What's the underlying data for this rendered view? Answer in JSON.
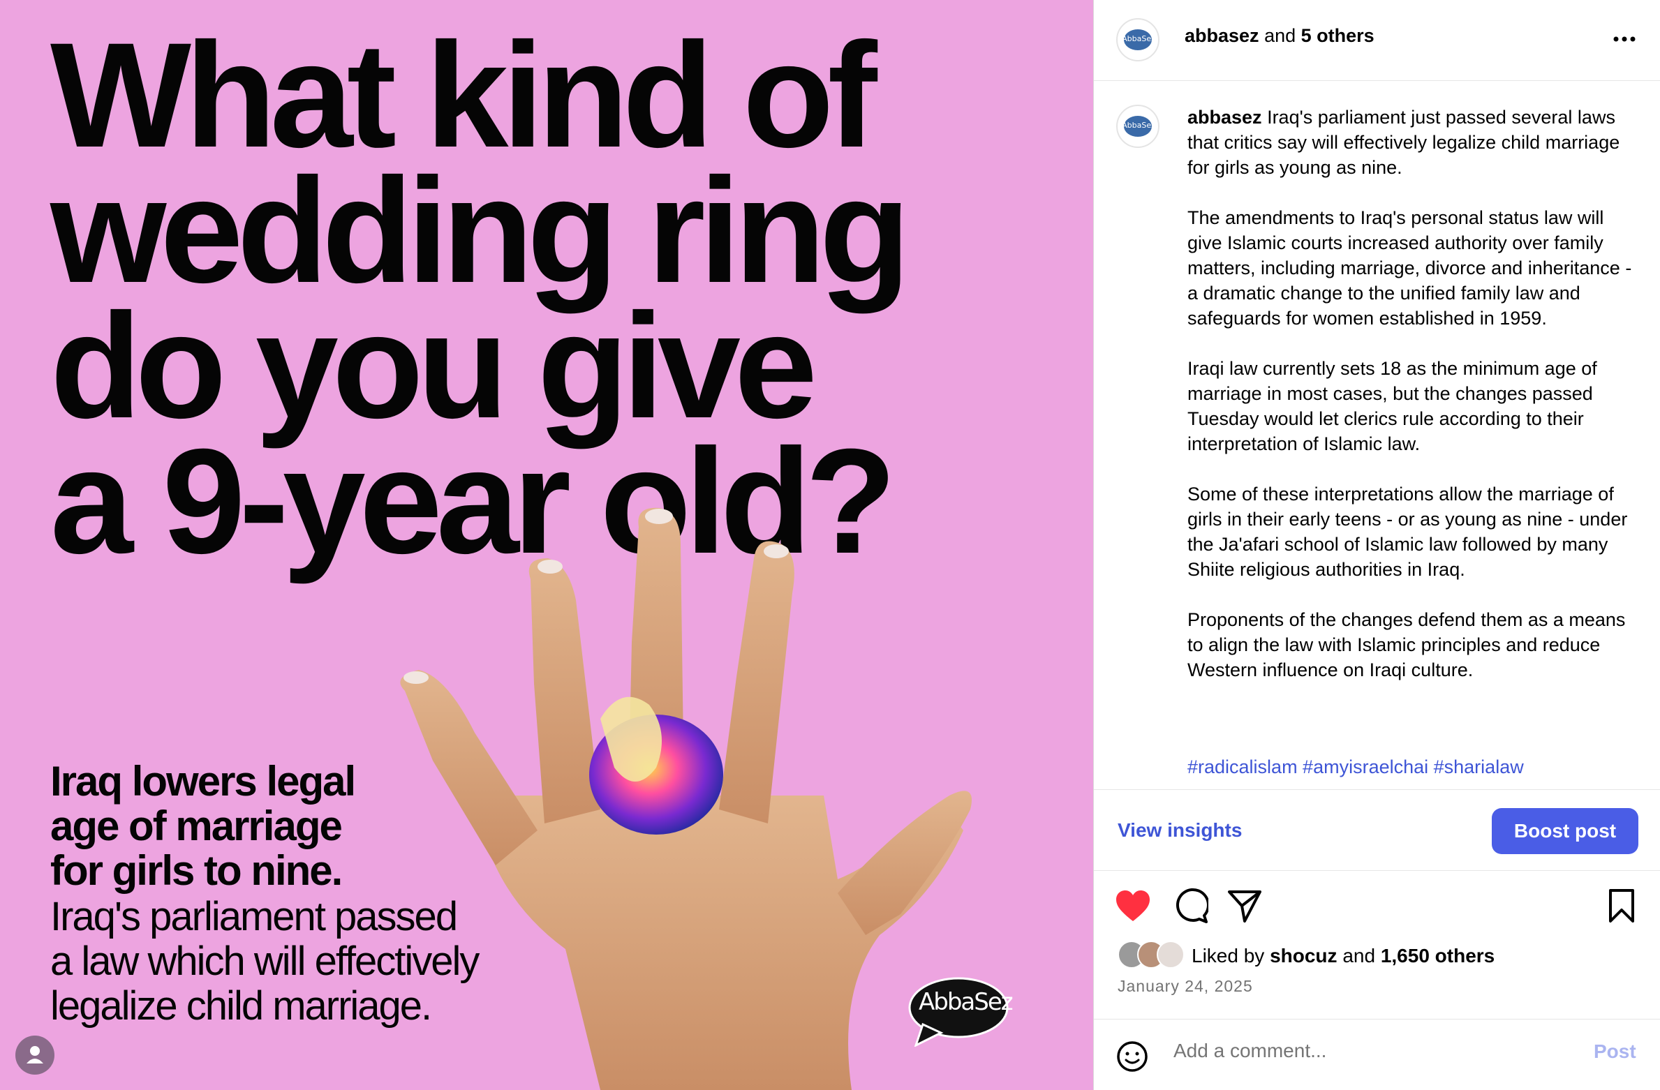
{
  "image": {
    "headline": "What kind of\nwedding ring\ndo you give\na 9-year old?",
    "subhead": "Iraq lowers legal\nage of marriage\nfor girls to nine.",
    "subtext": "Iraq's parliament passed\na law which will effectively\nlegalize child marriage.",
    "logo": "AbbaSez",
    "background_color": "#eda4e0"
  },
  "header": {
    "account": "abbasez",
    "and_text": " and ",
    "others": "5 others"
  },
  "caption": {
    "username": "abbasez",
    "body": " Iraq's parliament just passed several laws that critics say will effectively legalize child marriage for girls as young as nine.\n\nThe amendments to Iraq's personal status law will give Islamic courts increased authority over family matters, including marriage, divorce and inheritance - a dramatic change to the unified family law and safeguards for women established in 1959.\n\nIraqi law currently sets 18 as the minimum age of marriage in most cases, but the changes passed Tuesday would let clerics rule according to their interpretation of Islamic law.\n\nSome of these interpretations allow the marriage of girls in their early teens - or as young as nine - under the Ja'afari school of Islamic law followed by many Shiite religious authorities in Iraq.\n\nProponents of the changes defend them as a means to align the law with Islamic principles and reduce Western influence on Iraqi culture.",
    "hashtags": "#radicalislam #amyisraelchai #sharialaw"
  },
  "insights": {
    "view_label": "View insights",
    "boost_label": "Boost post"
  },
  "likes": {
    "prefix": "Liked by ",
    "user": "shocuz",
    "and_text": " and ",
    "count": "1,650 others"
  },
  "date": "January 24, 2025",
  "comment": {
    "placeholder": "Add a comment...",
    "post_label": "Post"
  },
  "colors": {
    "accent": "#4a5de6",
    "link": "#3e55d6",
    "like": "#ff3040"
  },
  "icons": [
    "heart-icon",
    "comment-icon",
    "share-icon",
    "bookmark-icon",
    "more-icon",
    "emoji-icon",
    "user-tag-icon"
  ]
}
